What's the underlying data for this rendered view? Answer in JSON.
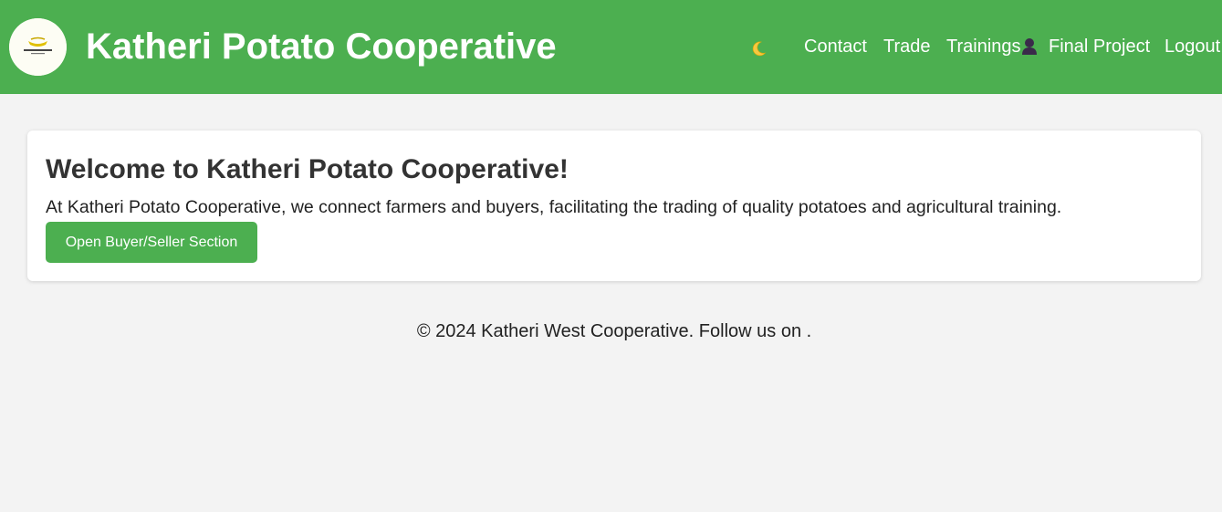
{
  "header": {
    "title": "Katheri Potato Cooperative",
    "logo_icon": "cooperative-logo",
    "logo_text": "Katheri Potato Cooperative",
    "theme_toggle_icon": "moon-icon",
    "user_icon": "user-icon",
    "nav": {
      "contact": "Contact",
      "trade": "Trade",
      "trainings": "Trainings",
      "final_project": "Final Project",
      "logout": "Logout"
    },
    "colors": {
      "background": "#4caf50",
      "text": "#ffffff"
    }
  },
  "main": {
    "title": "Welcome to Katheri Potato Cooperative!",
    "description": "At Katheri Potato Cooperative, we connect farmers and buyers, facilitating the trading of quality potatoes and agricultural training.",
    "button_label": "Open Buyer/Seller Section"
  },
  "footer": {
    "text": "© 2024 Katheri West Cooperative. Follow us on ."
  },
  "colors": {
    "accent": "#4caf50",
    "page_background": "#f3f3f3",
    "card_background": "#ffffff"
  }
}
